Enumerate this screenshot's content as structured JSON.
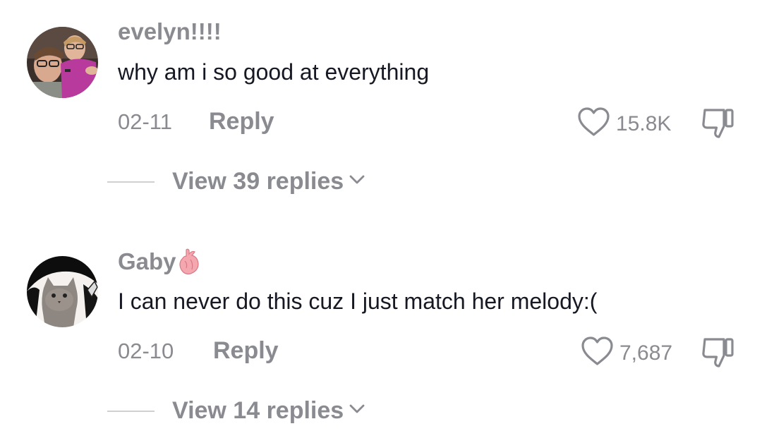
{
  "comments": [
    {
      "username": "evelyn!!!!",
      "text": "why am i so good at everything",
      "date": "02-11",
      "reply_label": "Reply",
      "likes": "15.8K",
      "view_replies": "View 39 replies"
    },
    {
      "username": "Gaby",
      "text": "I can never do this cuz I just match her melody:(",
      "date": "02-10",
      "reply_label": "Reply",
      "likes": "7,687",
      "view_replies": "View 14 replies"
    }
  ],
  "icons": {
    "like": "heart-outline-icon",
    "dislike": "thumbs-down-icon",
    "expand": "chevron-down-icon",
    "username_badge": "anatomical-heart-emoji"
  },
  "colors": {
    "text_primary": "#161823",
    "text_secondary": "#8a8b91",
    "divider": "#d0d0d3"
  }
}
